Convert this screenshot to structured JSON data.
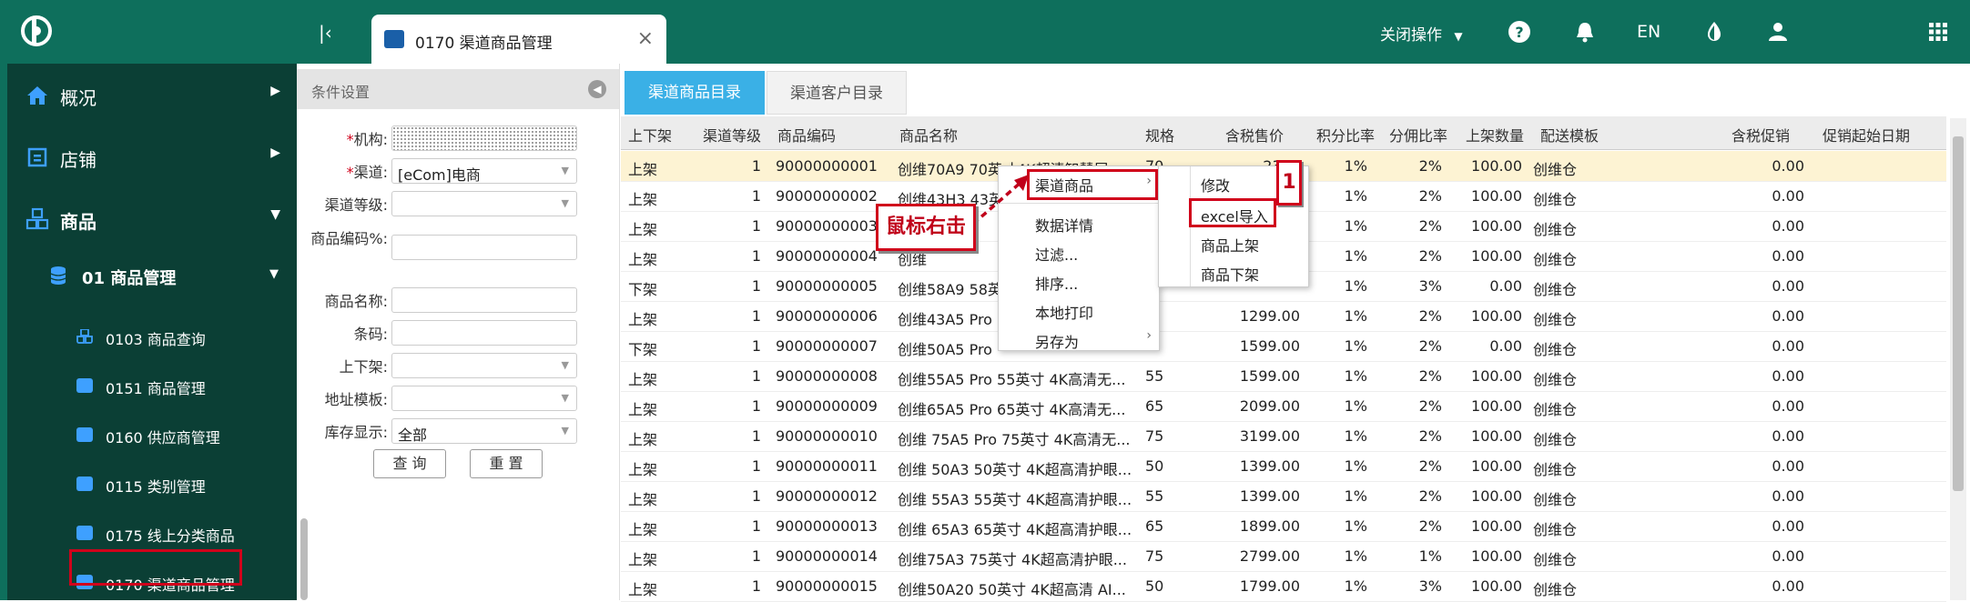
{
  "topbar": {
    "active_tab": "0170 渠道商品管理",
    "close_ops": "关闭操作",
    "lang": "EN"
  },
  "sidebar": {
    "items": [
      {
        "label": "概况",
        "icon": "home-icon"
      },
      {
        "label": "店铺",
        "icon": "shop-icon"
      },
      {
        "label": "商品",
        "icon": "goods-icon"
      }
    ],
    "group": "01 商品管理",
    "subitems": [
      {
        "label": "0103 商品查询"
      },
      {
        "label": "0151 商品管理"
      },
      {
        "label": "0160 供应商管理"
      },
      {
        "label": "0115 类别管理"
      },
      {
        "label": "0175 线上分类商品"
      },
      {
        "label": "0170 渠道商品管理"
      }
    ]
  },
  "conditions": {
    "title": "条件设置",
    "fields": [
      {
        "label": "机构:",
        "required": "*",
        "value": ""
      },
      {
        "label": "渠道:",
        "required": "*",
        "value": "[eCom]电商"
      },
      {
        "label": "渠道等级:",
        "required": "",
        "value": ""
      },
      {
        "label": "商品编码%:",
        "required": "",
        "value": ""
      },
      {
        "label": "商品名称:",
        "required": "",
        "value": ""
      },
      {
        "label": "条码:",
        "required": "",
        "value": ""
      },
      {
        "label": "上下架:",
        "required": "",
        "value": ""
      },
      {
        "label": "地址模板:",
        "required": "",
        "value": ""
      },
      {
        "label": "库存显示:",
        "required": "",
        "value": "全部"
      }
    ],
    "query_btn": "查 询",
    "reset_btn": "重 置"
  },
  "main": {
    "tabs": [
      "渠道商品目录",
      "渠道客户目录"
    ],
    "columns": [
      "上下架",
      "渠道等级",
      "商品编码",
      "商品名称",
      "规格",
      "含税售价",
      "积分比率",
      "分佣比率",
      "上架数量",
      "配送模板",
      "含税促销",
      "促销起始日期"
    ],
    "rows": [
      [
        "上架",
        "1",
        "90000000001",
        "创维70A9 70英寸4K超清智慧屏",
        "70",
        "2399",
        "1%",
        "2%",
        "100.00",
        "创维仓",
        "0.00"
      ],
      [
        "上架",
        "1",
        "90000000002",
        "创维43H3 43英",
        "",
        "",
        "1%",
        "2%",
        "100.00",
        "创维仓",
        "0.00"
      ],
      [
        "上架",
        "1",
        "90000000003",
        "创维",
        "",
        "",
        "1%",
        "2%",
        "100.00",
        "创维仓",
        "0.00"
      ],
      [
        "上架",
        "1",
        "90000000004",
        "创维",
        "",
        "",
        "1%",
        "2%",
        "100.00",
        "创维仓",
        "0.00"
      ],
      [
        "下架",
        "1",
        "90000000005",
        "创维58A9 58英",
        "",
        "",
        "1%",
        "3%",
        "0.00",
        "创维仓",
        "0.00"
      ],
      [
        "上架",
        "1",
        "90000000006",
        "创维43A5 Pro",
        "",
        "1299.00",
        "1%",
        "2%",
        "100.00",
        "创维仓",
        "0.00"
      ],
      [
        "下架",
        "1",
        "90000000007",
        "创维50A5 Pro",
        "",
        "1599.00",
        "1%",
        "2%",
        "0.00",
        "创维仓",
        "0.00"
      ],
      [
        "上架",
        "1",
        "90000000008",
        "创维55A5 Pro 55英寸 4K高清无...",
        "55",
        "1599.00",
        "1%",
        "2%",
        "100.00",
        "创维仓",
        "0.00"
      ],
      [
        "上架",
        "1",
        "90000000009",
        "创维65A5 Pro 65英寸 4K高清无...",
        "65",
        "2099.00",
        "1%",
        "2%",
        "100.00",
        "创维仓",
        "0.00"
      ],
      [
        "上架",
        "1",
        "90000000010",
        "创维 75A5 Pro 75英寸 4K高清无...",
        "75",
        "3199.00",
        "1%",
        "2%",
        "100.00",
        "创维仓",
        "0.00"
      ],
      [
        "上架",
        "1",
        "90000000011",
        "创维 50A3 50英寸 4K超高清护眼...",
        "50",
        "1399.00",
        "1%",
        "2%",
        "100.00",
        "创维仓",
        "0.00"
      ],
      [
        "上架",
        "1",
        "90000000012",
        "创维 55A3 55英寸 4K超高清护眼...",
        "55",
        "1399.00",
        "1%",
        "2%",
        "100.00",
        "创维仓",
        "0.00"
      ],
      [
        "上架",
        "1",
        "90000000013",
        "创维 65A3 65英寸 4K超高清护眼...",
        "65",
        "1899.00",
        "1%",
        "2%",
        "100.00",
        "创维仓",
        "0.00"
      ],
      [
        "上架",
        "1",
        "90000000014",
        "创维75A3 75英寸 4K超高清护眼...",
        "75",
        "2799.00",
        "1%",
        "1%",
        "100.00",
        "创维仓",
        "0.00"
      ],
      [
        "上架",
        "1",
        "90000000015",
        "创维50A20 50英寸 4K超高清 AI...",
        "50",
        "1799.00",
        "1%",
        "3%",
        "100.00",
        "创维仓",
        "0.00"
      ]
    ]
  },
  "context_menu": {
    "items": [
      "渠道商品",
      "数据详情",
      "过滤...",
      "排序...",
      "本地打印",
      "另存为"
    ],
    "submenu": [
      "修改",
      "excel导入",
      "商品上架",
      "商品下架"
    ]
  },
  "annotations": {
    "callout": "鼠标右击",
    "step": "1"
  },
  "colors": {
    "brand": "#0e6f5c",
    "sidebar": "#0b3f35",
    "tab_active": "#3ab0e6",
    "highlight_row": "#fdf3d3",
    "annotation_red": "#d0021b"
  }
}
